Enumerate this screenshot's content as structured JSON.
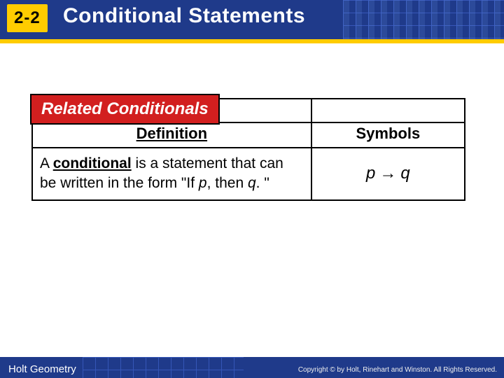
{
  "header": {
    "lesson_number": "2-2",
    "title": "Conditional Statements"
  },
  "table": {
    "caption": "Related Conditionals",
    "head_definition": "Definition",
    "head_symbols": "Symbols",
    "definition_prefix": "A ",
    "definition_term": "conditional",
    "definition_mid": " is a statement that can be written in the form \"If ",
    "definition_p": "p",
    "definition_mid2": ", then ",
    "definition_q": "q",
    "definition_suffix": ". \"",
    "symbol_p": "p",
    "symbol_arrow": "→",
    "symbol_q": "q"
  },
  "footer": {
    "book": "Holt Geometry",
    "copyright": "Copyright © by Holt, Rinehart and Winston. All Rights Reserved."
  }
}
